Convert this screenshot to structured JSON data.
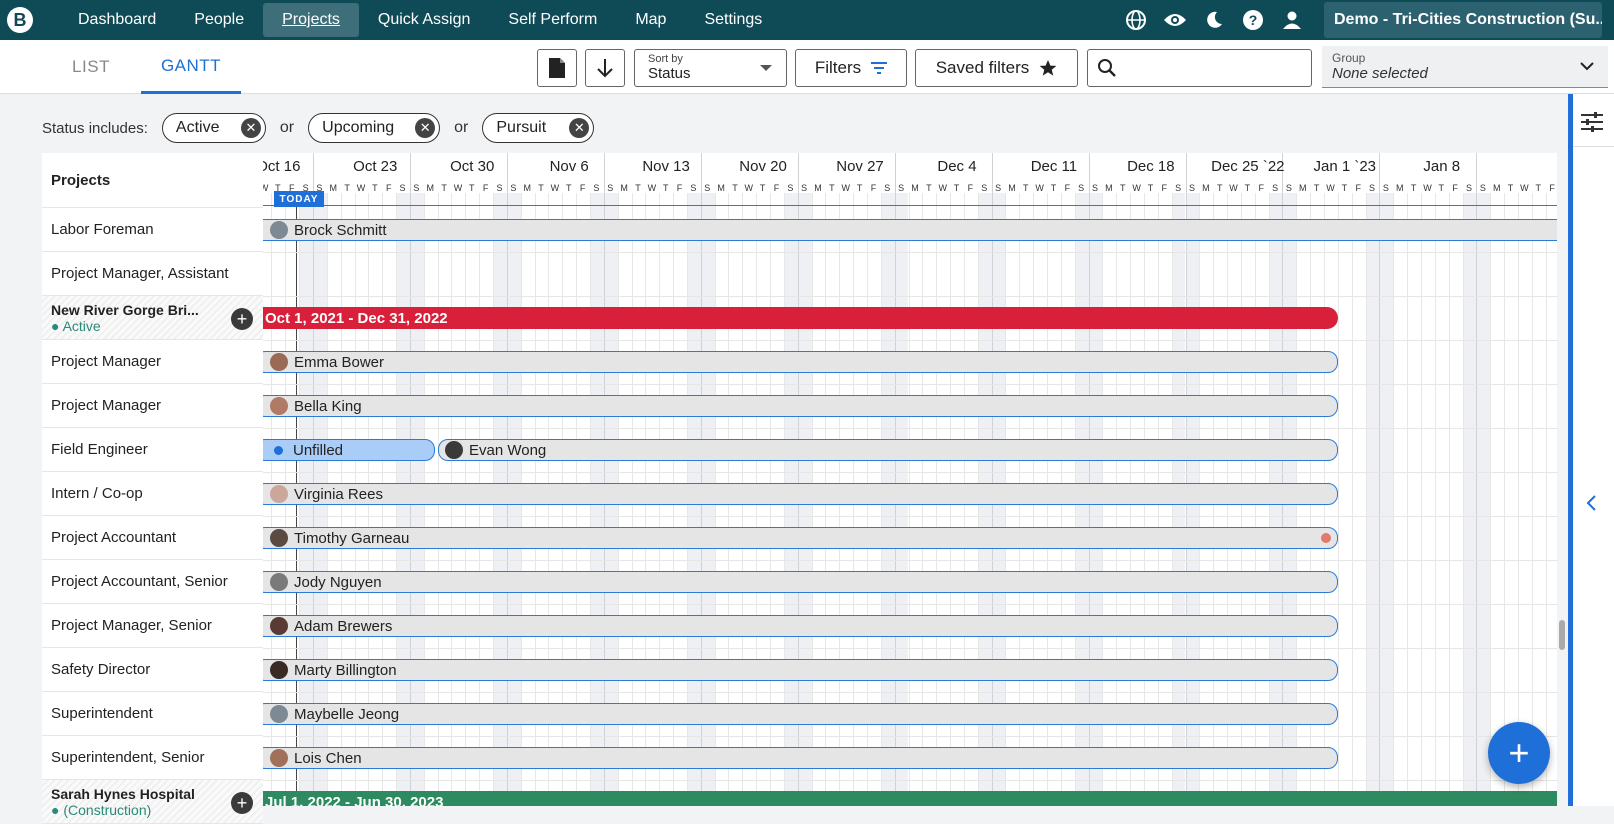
{
  "nav": {
    "items": [
      {
        "label": "Dashboard",
        "active": false
      },
      {
        "label": "People",
        "active": false
      },
      {
        "label": "Projects",
        "active": true
      },
      {
        "label": "Quick Assign",
        "active": false
      },
      {
        "label": "Self Perform",
        "active": false
      },
      {
        "label": "Map",
        "active": false
      },
      {
        "label": "Settings",
        "active": false
      }
    ],
    "company": "Demo - Tri-Cities Construction (Su..."
  },
  "toolbar": {
    "tab_list": "LIST",
    "tab_gantt": "GANTT",
    "sort_label": "Sort by",
    "sort_value": "Status",
    "filters_label": "Filters",
    "saved_filters_label": "Saved filters",
    "group_label": "Group",
    "group_value": "None selected"
  },
  "filters": {
    "label": "Status includes:",
    "chips": [
      "Active",
      "Upcoming",
      "Pursuit"
    ],
    "joiner": "or"
  },
  "gantt": {
    "projects_header": "Projects",
    "today_label": "TODAY",
    "weeks": [
      "Oct 16",
      "Oct 23",
      "Oct 30",
      "Nov 6",
      "Nov 13",
      "Nov 20",
      "Nov 27",
      "Dec 4",
      "Dec 11",
      "Dec 18",
      "Dec 25 `22",
      "Jan 1 `23",
      "Jan 8"
    ],
    "day_letters": [
      "S",
      "M",
      "T",
      "W",
      "T",
      "F",
      "S"
    ],
    "rows": [
      {
        "kind": "role",
        "role": "Labor Foreman",
        "person": "Brock Schmitt"
      },
      {
        "kind": "role",
        "role": "Project Manager, Assistant",
        "person": ""
      },
      {
        "kind": "project",
        "name": "New River Gorge Bri...",
        "status": "● Active",
        "dates": "Oct 1, 2021 - Dec 31, 2022",
        "color": "#d9203a"
      },
      {
        "kind": "role",
        "role": "Project Manager",
        "person": "Emma Bower"
      },
      {
        "kind": "role",
        "role": "Project Manager",
        "person": "Bella King"
      },
      {
        "kind": "role",
        "role": "Field Engineer",
        "person": "Evan Wong",
        "unfilled": "Unfilled"
      },
      {
        "kind": "role",
        "role": "Intern / Co-op",
        "person": "Virginia Rees"
      },
      {
        "kind": "role",
        "role": "Project Accountant",
        "person": "Timothy Garneau"
      },
      {
        "kind": "role",
        "role": "Project Accountant, Senior",
        "person": "Jody Nguyen"
      },
      {
        "kind": "role",
        "role": "Project Manager, Senior",
        "person": "Adam Brewers"
      },
      {
        "kind": "role",
        "role": "Safety Director",
        "person": "Marty Billington"
      },
      {
        "kind": "role",
        "role": "Superintendent",
        "person": "Maybelle Jeong"
      },
      {
        "kind": "role",
        "role": "Superintendent, Senior",
        "person": "Lois Chen"
      },
      {
        "kind": "project",
        "name": "Sarah Hynes Hospital",
        "status": "● (Construction)",
        "dates": "Jul 1, 2022 - Jun 30, 2023",
        "color": "#2e8a61"
      }
    ]
  },
  "colors": {
    "nav_bg": "#0f4a57",
    "accent": "#1f6fd8",
    "active_status": "#2a8a78"
  }
}
